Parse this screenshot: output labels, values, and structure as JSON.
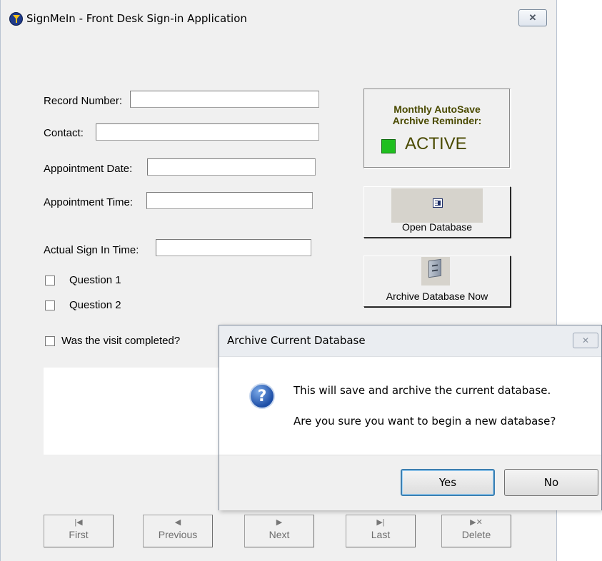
{
  "window": {
    "title": "SignMeIn - Front Desk Sign-in Application",
    "close_symbol": "✕"
  },
  "form": {
    "record_number_label": "Record Number:",
    "record_number_value": "",
    "contact_label": "Contact:",
    "contact_value": "",
    "appointment_date_label": "Appointment Date:",
    "appointment_date_value": "",
    "appointment_time_label": "Appointment Time:",
    "appointment_time_value": "",
    "sign_in_time_label": "Actual Sign In Time:",
    "sign_in_time_value": "",
    "question1_label": "Question 1",
    "question1_checked": false,
    "question2_label": "Question 2",
    "question2_checked": false,
    "visit_completed_label": "Was the visit completed?",
    "visit_completed_checked": false
  },
  "reminder": {
    "line1": "Monthly AutoSave",
    "line2": "Archive Reminder:",
    "status": "ACTIVE",
    "status_color": "#1fbf1f"
  },
  "buttons": {
    "open_database": "Open Database",
    "archive_database": "Archive Database Now"
  },
  "nav": [
    {
      "label": "First",
      "icon": "|◀"
    },
    {
      "label": "Previous",
      "icon": "◀"
    },
    {
      "label": "Next",
      "icon": "▶"
    },
    {
      "label": "Last",
      "icon": "▶|"
    },
    {
      "label": "Delete",
      "icon": "▶✕"
    }
  ],
  "dialog": {
    "title": "Archive Current Database",
    "message1": "This will save and archive the current database.",
    "message2": "Are you sure you want to begin a new database?",
    "yes": "Yes",
    "no": "No",
    "close_symbol": "✕",
    "icon_glyph": "?"
  }
}
